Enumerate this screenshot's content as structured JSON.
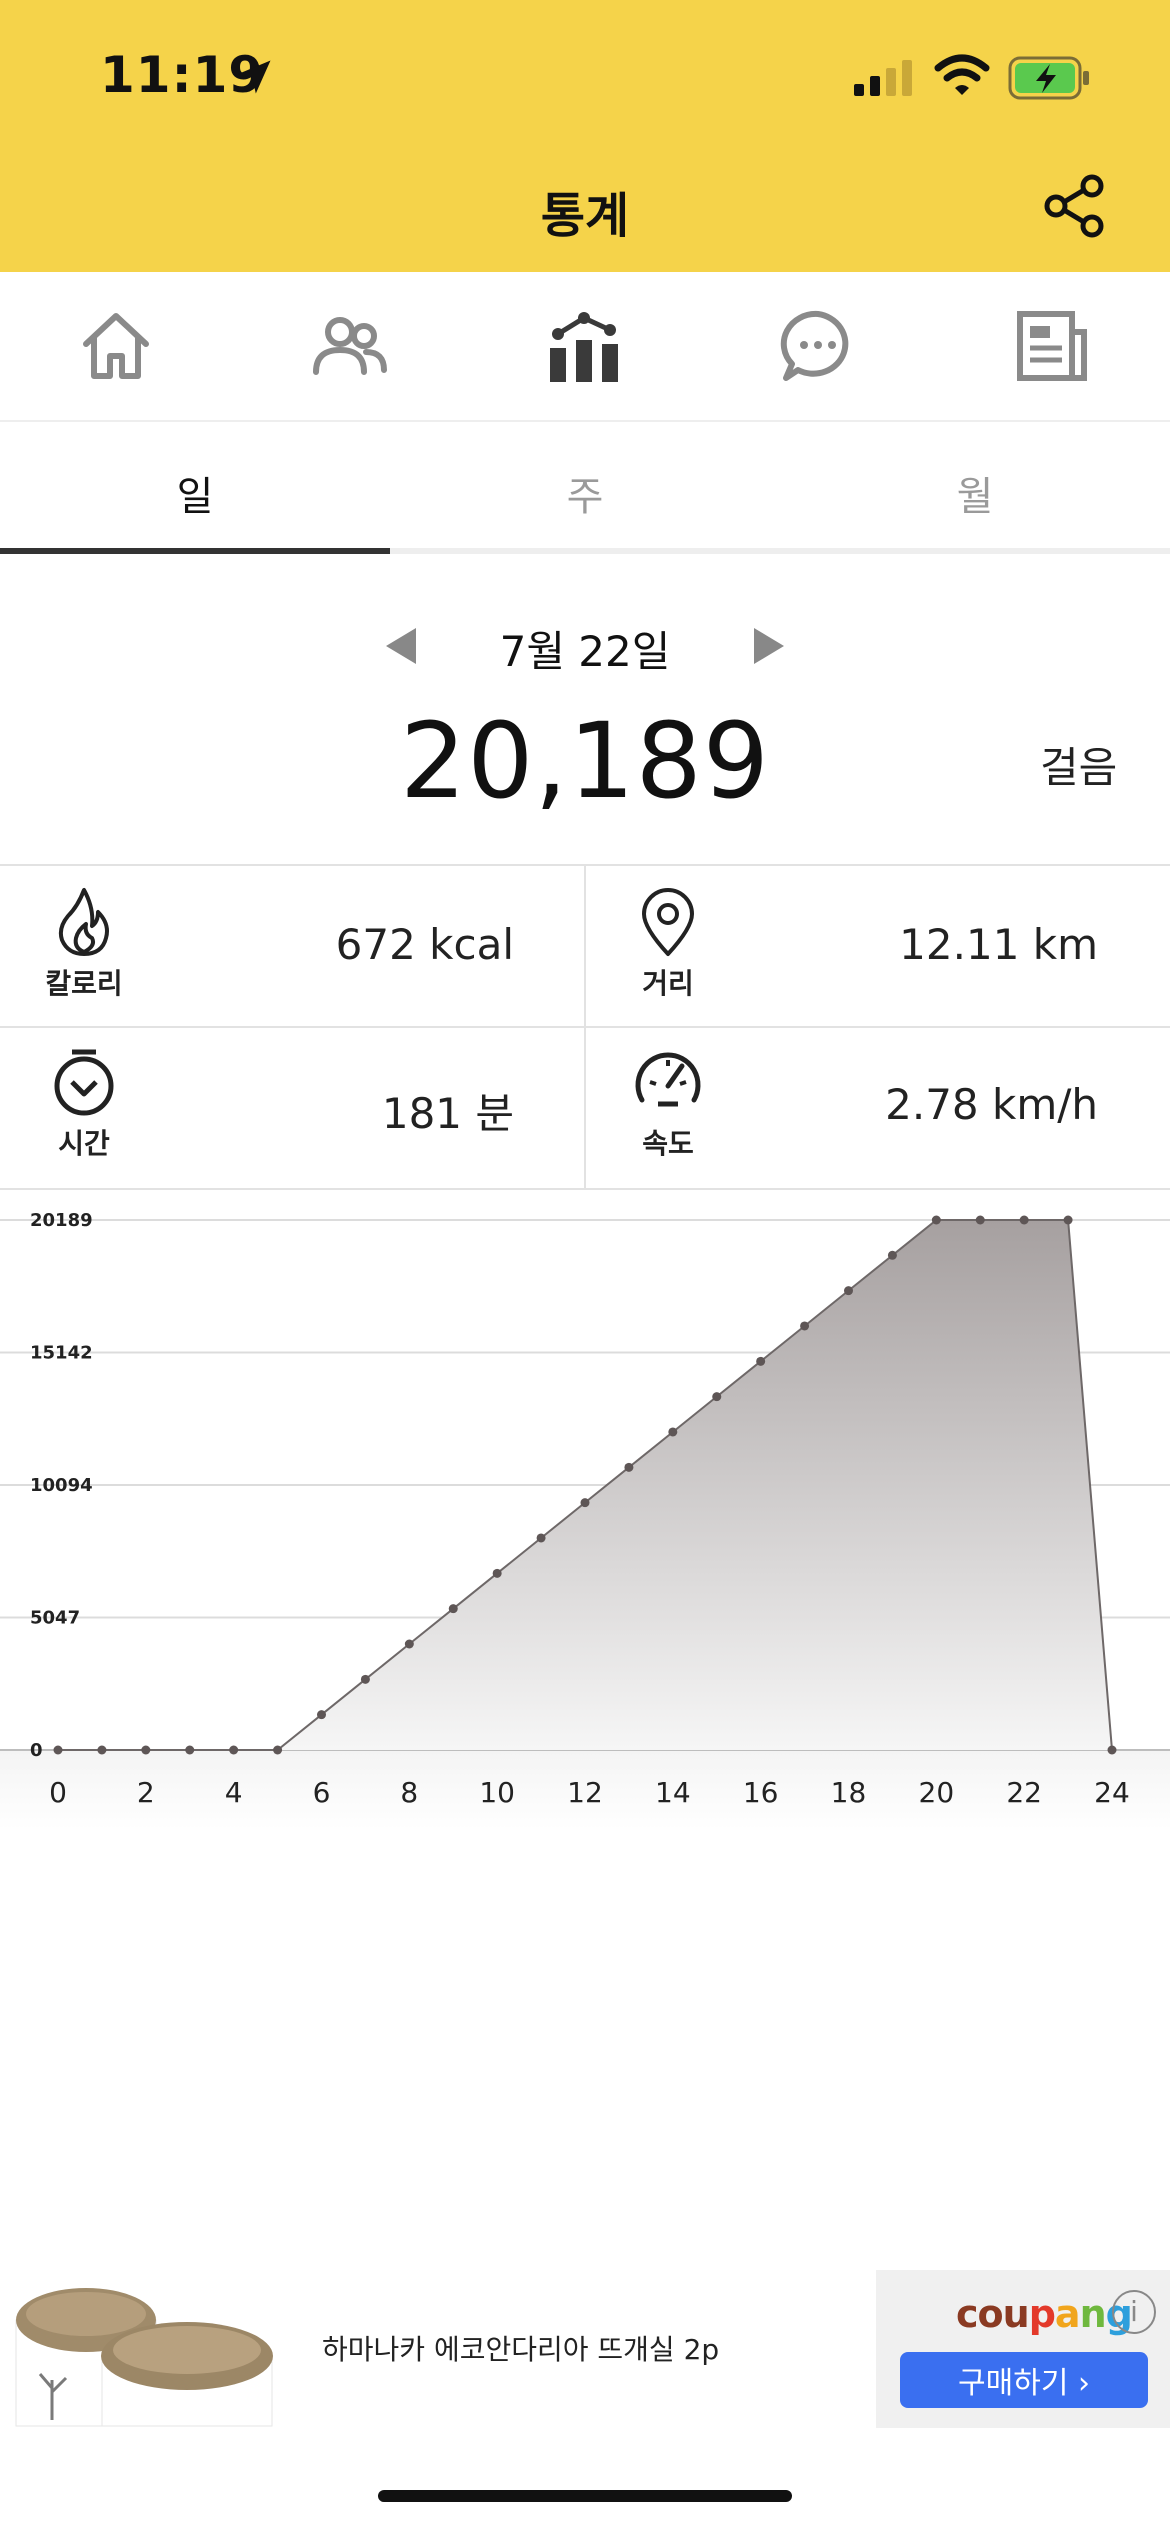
{
  "status_bar": {
    "time": "11:19"
  },
  "header": {
    "title": "통계"
  },
  "nav": {
    "items": [
      {
        "icon": "home-icon",
        "active": false
      },
      {
        "icon": "friends-icon",
        "active": false
      },
      {
        "icon": "stats-icon",
        "active": true
      },
      {
        "icon": "chat-icon",
        "active": false
      },
      {
        "icon": "news-icon",
        "active": false
      }
    ]
  },
  "tabs": [
    {
      "label": "일",
      "active": true
    },
    {
      "label": "주",
      "active": false
    },
    {
      "label": "월",
      "active": false
    }
  ],
  "summary": {
    "date": "7월 22일",
    "steps": "20,189",
    "steps_unit": "걸음"
  },
  "stats": {
    "calories": {
      "label": "칼로리",
      "value": "672 kcal"
    },
    "distance": {
      "label": "거리",
      "value": "12.11 km"
    },
    "time": {
      "label": "시간",
      "value": "181 분"
    },
    "speed": {
      "label": "속도",
      "value": "2.78 km/h"
    }
  },
  "chart_data": {
    "type": "area",
    "x": [
      0,
      1,
      2,
      3,
      4,
      5,
      6,
      7,
      8,
      9,
      10,
      11,
      12,
      13,
      14,
      15,
      16,
      17,
      18,
      19,
      20,
      21,
      22,
      23,
      24
    ],
    "values": [
      0,
      0,
      0,
      0,
      0,
      0,
      1346,
      2692,
      4038,
      5384,
      6730,
      8076,
      9422,
      10768,
      12114,
      13460,
      14806,
      16152,
      17498,
      18844,
      20189,
      20189,
      20189,
      20189,
      0
    ],
    "xticks": [
      "0",
      "2",
      "4",
      "6",
      "8",
      "10",
      "12",
      "14",
      "16",
      "18",
      "20",
      "22",
      "24"
    ],
    "yticks": [
      "0",
      "5047",
      "10094",
      "15142",
      "20189"
    ],
    "ylim": [
      0,
      20189
    ],
    "xlim": [
      0,
      24
    ],
    "grid": true,
    "colors": {
      "line": "#6e6868",
      "fill_top": "#a6a0a0",
      "fill_bottom": "#f6f6f6",
      "point": "#5e5656"
    }
  },
  "ad": {
    "text": "하마나카 에코안다리아 뜨개실 2p",
    "brand": "coupang",
    "button_label": "구매하기 ›",
    "info_label": "i"
  },
  "colors": {
    "header_bg": "#F5D34A",
    "accent": "#3a6ff0"
  }
}
